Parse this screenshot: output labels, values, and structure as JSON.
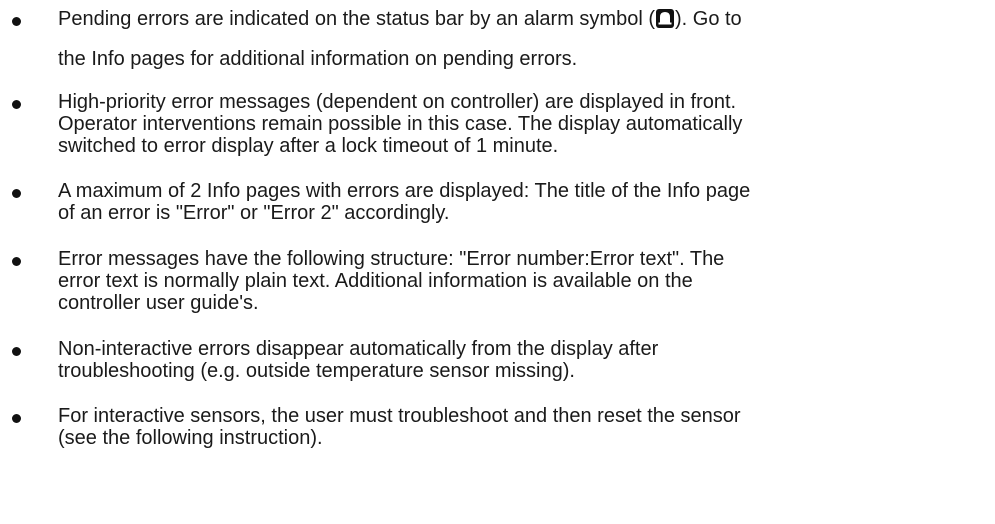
{
  "items": [
    {
      "before_icon": "Pending errors are indicated on the status bar by an alarm symbol (",
      "icon": "alarm-bell-icon",
      "after_icon": "). Go to",
      "line2": "the Info pages for additional information on pending errors."
    },
    {
      "lines": [
        "High-priority error messages (dependent on controller) are displayed in front.",
        "Operator interventions remain possible in this case. The display automatically",
        "switched to error display after a lock timeout of 1 minute."
      ]
    },
    {
      "lines": [
        "A maximum of 2 Info pages with errors are displayed: The title of the Info page",
        "of an error is \"Error\" or \"Error 2\" accordingly."
      ]
    },
    {
      "lines": [
        "Error messages have the following structure: \"Error number:Error text\". The",
        "error text is normally plain text. Additional information is available on the",
        "controller user guide's."
      ]
    },
    {
      "lines": [
        "Non-interactive errors disappear automatically from the display after",
        "troubleshooting (e.g. outside temperature sensor missing)."
      ]
    },
    {
      "lines": [
        "For interactive sensors, the user must troubleshoot and then reset the sensor",
        "(see the following instruction)."
      ]
    }
  ]
}
